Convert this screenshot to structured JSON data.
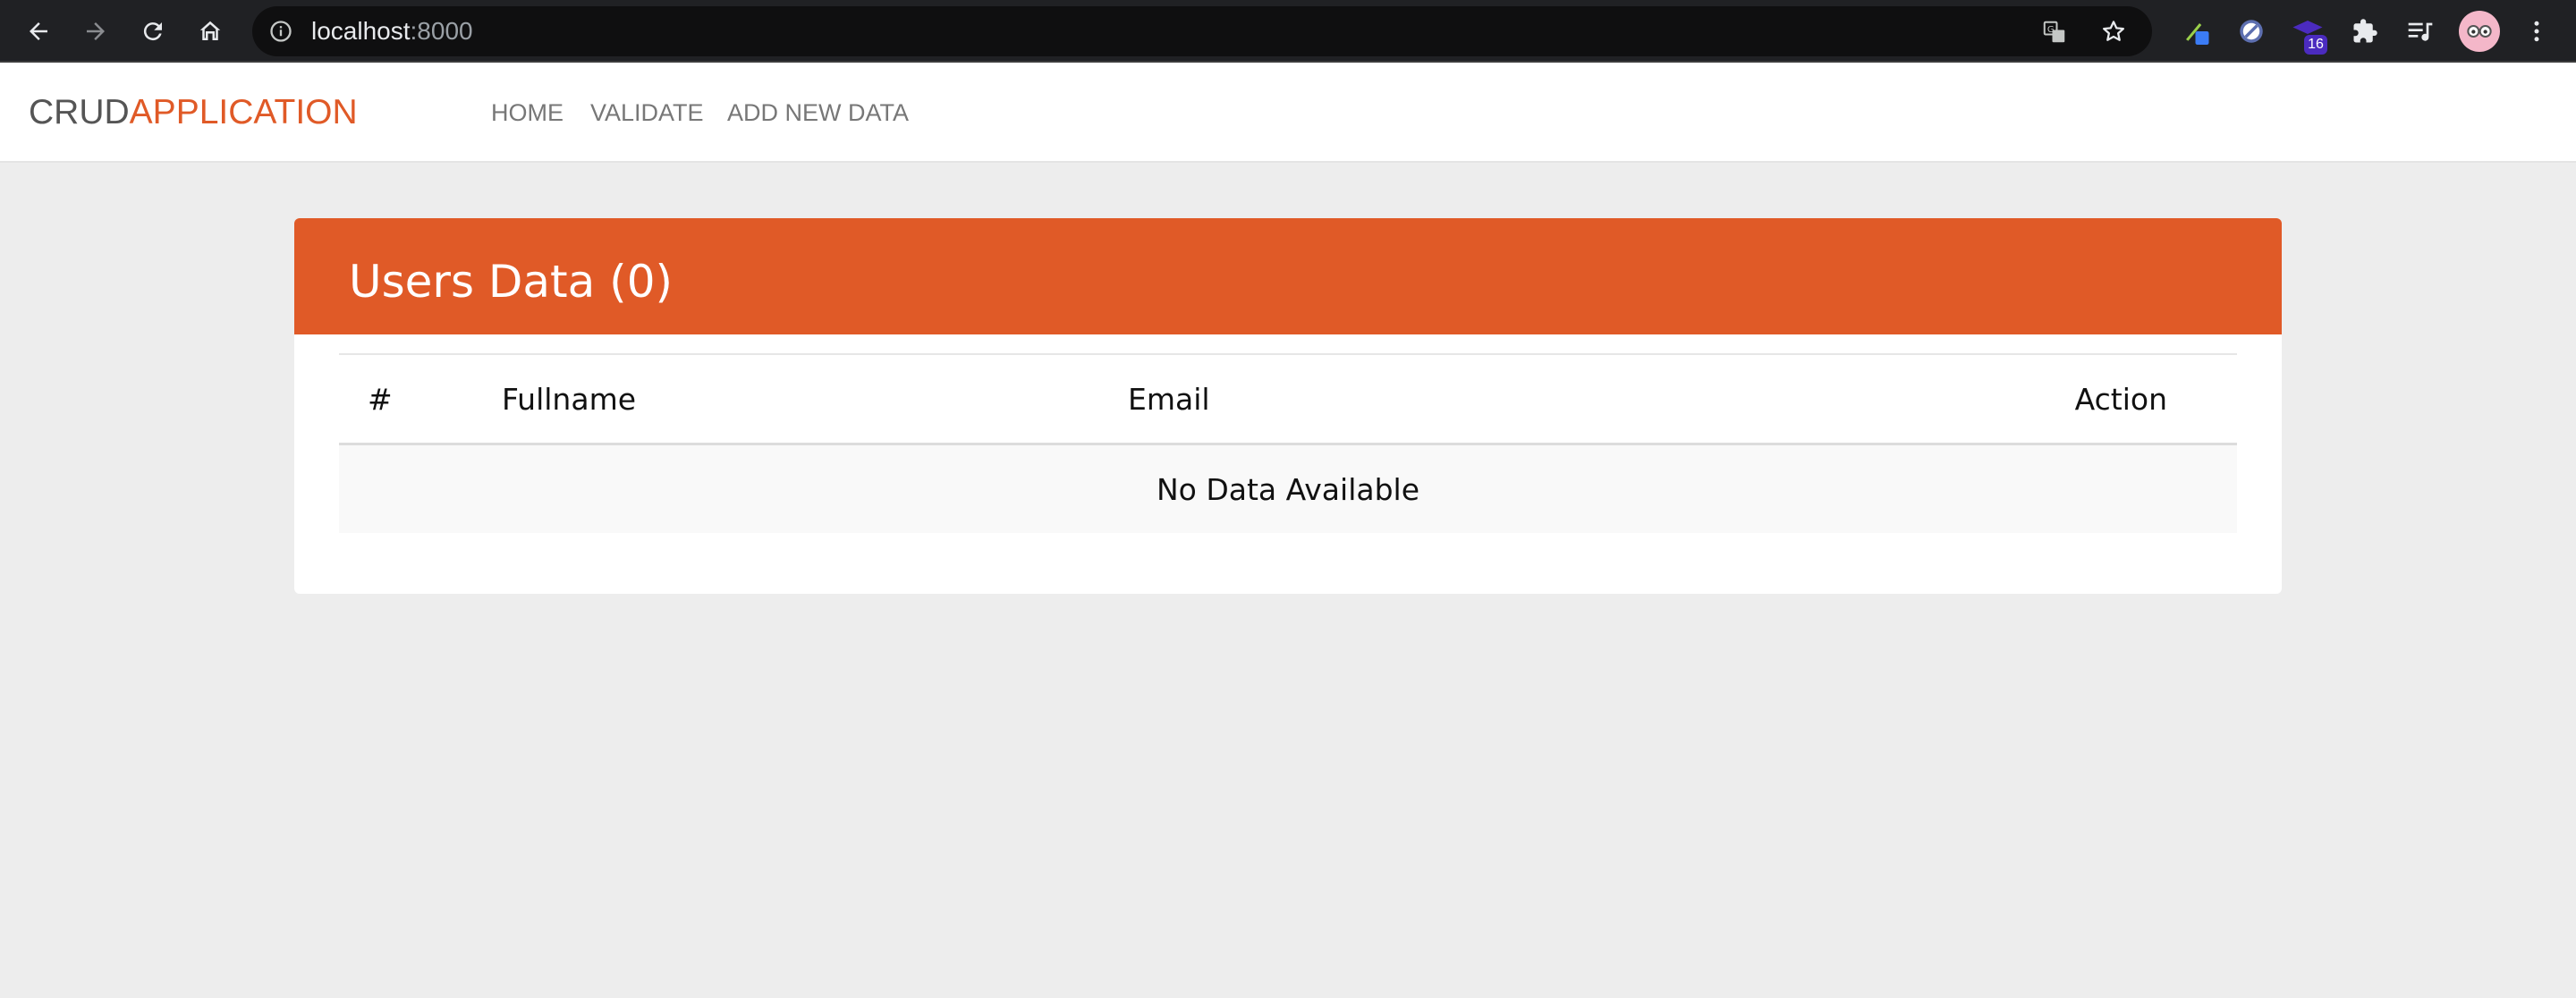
{
  "browser": {
    "url_host": "localhost",
    "url_port": ":8000",
    "extension_badge": "16",
    "accent_color": "#202124"
  },
  "navbar": {
    "brand_part1": "CRUD",
    "brand_part2": "APPLICATION",
    "links": [
      "HOME",
      "VALIDATE",
      "ADD NEW DATA"
    ],
    "brand_accent_color": "#e05a27"
  },
  "card": {
    "title": "Users Data (0)",
    "header_color": "#e05a27",
    "columns": [
      "#",
      "Fullname",
      "Email",
      "Action"
    ],
    "empty_message": "No Data Available"
  }
}
